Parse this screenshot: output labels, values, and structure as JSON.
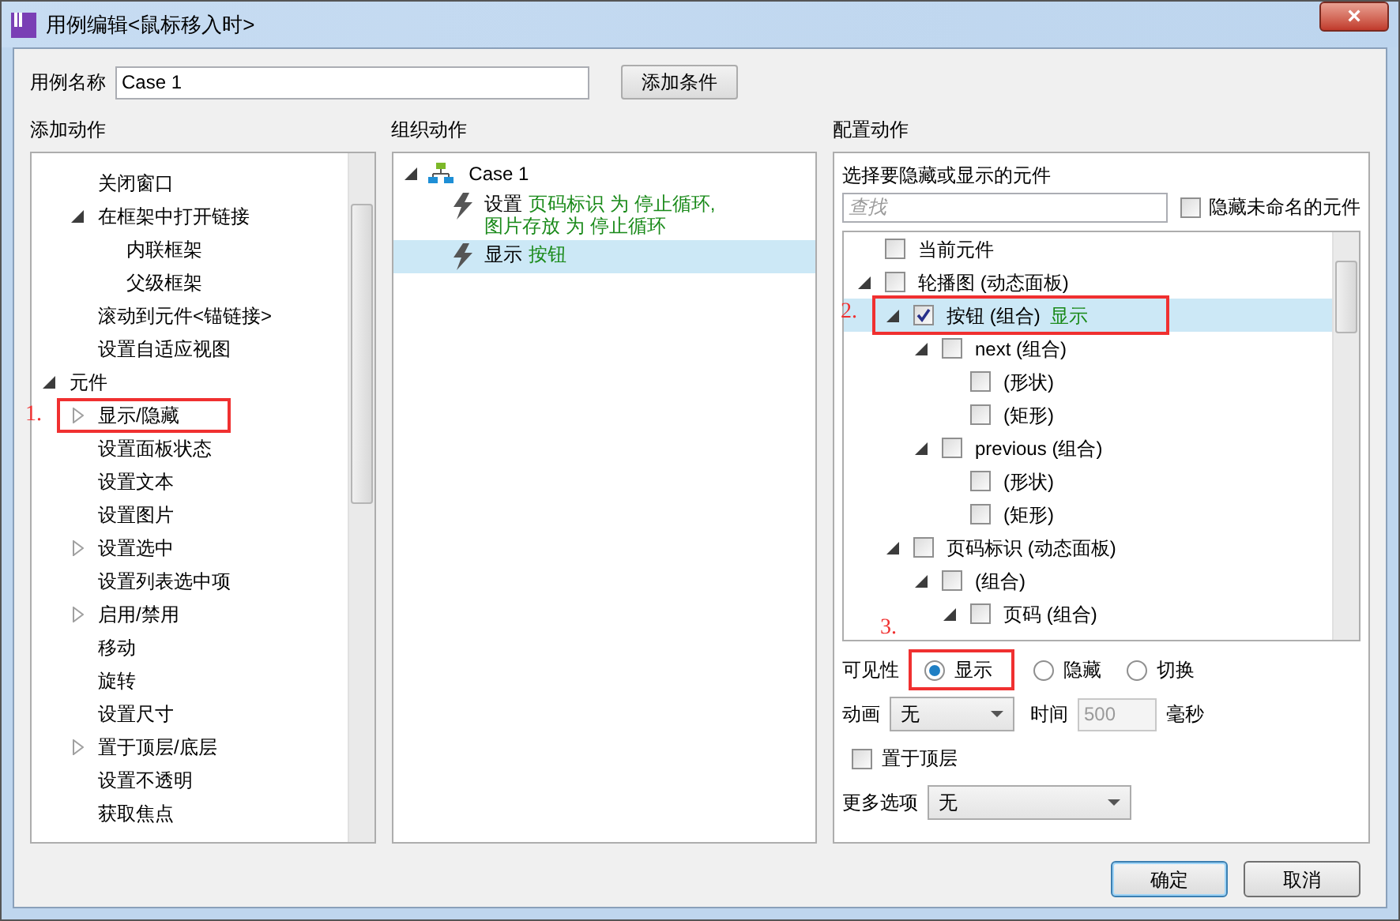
{
  "window": {
    "title": "用例编辑<鼠标移入时>",
    "close": "×"
  },
  "case_name": {
    "label": "用例名称",
    "value": "Case 1",
    "add_condition": "添加条件"
  },
  "add_actions": {
    "title": "添加动作",
    "tree": [
      {
        "children": [
          {
            "label": "关闭窗口"
          },
          {
            "label": "在框架中打开链接",
            "expanded": true,
            "children": [
              {
                "label": "内联框架"
              },
              {
                "label": "父级框架"
              }
            ]
          },
          {
            "label": "滚动到元件<锚链接>"
          },
          {
            "label": "设置自适应视图"
          }
        ]
      },
      {
        "label": "元件",
        "expanded": true,
        "children": [
          {
            "label": "显示/隐藏",
            "expanded": false,
            "annotation": "1."
          },
          {
            "label": "设置面板状态"
          },
          {
            "label": "设置文本"
          },
          {
            "label": "设置图片"
          },
          {
            "label": "设置选中",
            "expanded": false
          },
          {
            "label": "设置列表选中项"
          },
          {
            "label": "启用/禁用",
            "expanded": false
          },
          {
            "label": "移动"
          },
          {
            "label": "旋转"
          },
          {
            "label": "设置尺寸"
          },
          {
            "label": "置于顶层/底层",
            "expanded": false
          },
          {
            "label": "设置不透明"
          },
          {
            "label": "获取焦点"
          }
        ]
      }
    ]
  },
  "organize_actions": {
    "title": "组织动作",
    "case": {
      "label": "Case 1",
      "expanded": true,
      "actions": [
        {
          "selected": false,
          "lines": [
            [
              {
                "kind": "verb",
                "text": "设置"
              },
              {
                "kind": "target",
                "text": "页码标识 为 停止循环,"
              }
            ],
            [
              {
                "kind": "target",
                "text": "图片存放 为 停止循环"
              }
            ]
          ]
        },
        {
          "selected": true,
          "lines": [
            [
              {
                "kind": "verb",
                "text": "显示"
              },
              {
                "kind": "target",
                "text": "按钮"
              }
            ]
          ]
        }
      ]
    }
  },
  "configure_action": {
    "title": "配置动作",
    "subtitle": "选择要隐藏或显示的元件",
    "search": {
      "placeholder": "查找"
    },
    "hide_unnamed": {
      "label": "隐藏未命名的元件",
      "checked": false
    },
    "tree": [
      {
        "label": "当前元件",
        "checked": false
      },
      {
        "label": "轮播图 (动态面板)",
        "checked": false,
        "expanded": true,
        "children": [
          {
            "label": "按钮 (组合)",
            "checked": true,
            "selected": true,
            "status": "显示",
            "expanded": true,
            "annotation": "2.",
            "children": [
              {
                "label": "next (组合)",
                "checked": false,
                "expanded": true,
                "children": [
                  {
                    "label": "(形状)",
                    "checked": false
                  },
                  {
                    "label": "(矩形)",
                    "checked": false
                  }
                ]
              },
              {
                "label": "previous (组合)",
                "checked": false,
                "expanded": true,
                "children": [
                  {
                    "label": "(形状)",
                    "checked": false
                  },
                  {
                    "label": "(矩形)",
                    "checked": false
                  }
                ]
              }
            ]
          },
          {
            "label": "页码标识 (动态面板)",
            "checked": false,
            "expanded": true,
            "children": [
              {
                "label": "(组合)",
                "checked": false,
                "expanded": true,
                "children": [
                  {
                    "label": "页码 (组合)",
                    "checked": false,
                    "expanded": true
                  }
                ]
              }
            ]
          }
        ]
      }
    ],
    "visibility": {
      "label": "可见性",
      "options": [
        {
          "label": "显示",
          "selected": true,
          "annotation": "3."
        },
        {
          "label": "隐藏",
          "selected": false
        },
        {
          "label": "切换",
          "selected": false
        }
      ]
    },
    "animation": {
      "label": "动画",
      "value": "无",
      "time_label": "时间",
      "time_value": "500",
      "time_disabled": true,
      "unit": "毫秒"
    },
    "bring_to_front": {
      "label": "置于顶层",
      "checked": false
    },
    "more_options": {
      "label": "更多选项",
      "value": "无"
    }
  },
  "buttons": [
    {
      "label": "确定",
      "default": true
    },
    {
      "label": "取消",
      "default": false
    }
  ]
}
